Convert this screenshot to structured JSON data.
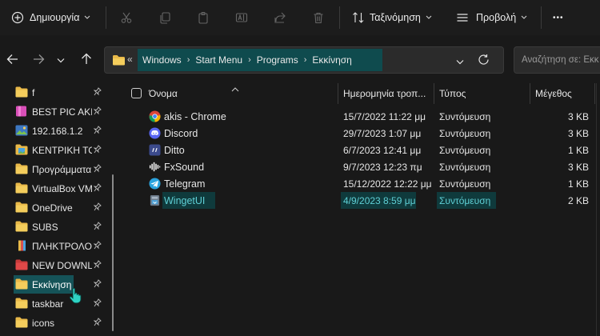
{
  "toolbar": {
    "new_label": "Δημιουργία",
    "sort_label": "Ταξινόμηση",
    "view_label": "Προβολή",
    "more_label": "•••"
  },
  "address": {
    "overflow": "«",
    "breadcrumbs": [
      "Windows",
      "Start Menu",
      "Programs",
      "Εκκίνηση"
    ],
    "separator": "›"
  },
  "search": {
    "placeholder": "Αναζήτηση σε: Εκκ"
  },
  "sidebar": {
    "items": [
      {
        "label": "f",
        "icon": "folder-icon",
        "color": "#e9b949"
      },
      {
        "label": "BEST PIC AKIS",
        "icon": "pink-folder-icon",
        "color": "#e060c0"
      },
      {
        "label": "192.168.1.2",
        "icon": "network-image-icon",
        "color": "#6ab04c"
      },
      {
        "label": "ΚΕΝΤΡΙΚΗ ΤΟΙ",
        "icon": "image-folder-icon",
        "color": "#e9b949"
      },
      {
        "label": "Προγράμματα",
        "icon": "folder-icon",
        "color": "#e9b949"
      },
      {
        "label": "VirtualBox VM",
        "icon": "folder-icon",
        "color": "#e9b949"
      },
      {
        "label": "OneDrive",
        "icon": "folder-icon",
        "color": "#e9b949"
      },
      {
        "label": "SUBS",
        "icon": "folder-icon",
        "color": "#e9b949"
      },
      {
        "label": "ΠΛΗΚΤΡΟΛΟΓ",
        "icon": "multicolor-folder-icon",
        "color": "#d9534f"
      },
      {
        "label": "NEW DOWNLC",
        "icon": "red-folder-icon",
        "color": "#e04040"
      },
      {
        "label": "Εκκίνηση",
        "icon": "folder-icon",
        "color": "#e9b949"
      },
      {
        "label": "taskbar",
        "icon": "folder-icon",
        "color": "#e9b949"
      },
      {
        "label": "icons",
        "icon": "folder-icon",
        "color": "#e9b949"
      }
    ],
    "selected_index": 10
  },
  "columns": {
    "name": "Όνομα",
    "date": "Ημερομηνία τροπ...",
    "type": "Τύπος",
    "size": "Μέγεθος"
  },
  "files": [
    {
      "name": "akis - Chrome",
      "date": "15/7/2022 11:22 μμ",
      "type": "Συντόμευση",
      "size": "3 KB",
      "icon": "chrome-icon"
    },
    {
      "name": "Discord",
      "date": "29/7/2023 1:07 μμ",
      "type": "Συντόμευση",
      "size": "3 KB",
      "icon": "discord-icon"
    },
    {
      "name": "Ditto",
      "date": "6/7/2023 12:41 μμ",
      "type": "Συντόμευση",
      "size": "1 KB",
      "icon": "ditto-icon"
    },
    {
      "name": "FxSound",
      "date": "9/7/2023 12:23 πμ",
      "type": "Συντόμευση",
      "size": "3 KB",
      "icon": "fxsound-icon"
    },
    {
      "name": "Telegram",
      "date": "15/12/2022 12:22 μμ",
      "type": "Συντόμευση",
      "size": "1 KB",
      "icon": "telegram-icon"
    },
    {
      "name": "WingetUI",
      "date": "4/9/2023 8:59 μμ",
      "type": "Συντόμευση",
      "size": "2 KB",
      "icon": "wingetui-icon"
    }
  ],
  "selected_file_index": 5,
  "colors": {
    "accent": "#155358",
    "selected_text": "#5fd0d6",
    "background": "#191919"
  }
}
